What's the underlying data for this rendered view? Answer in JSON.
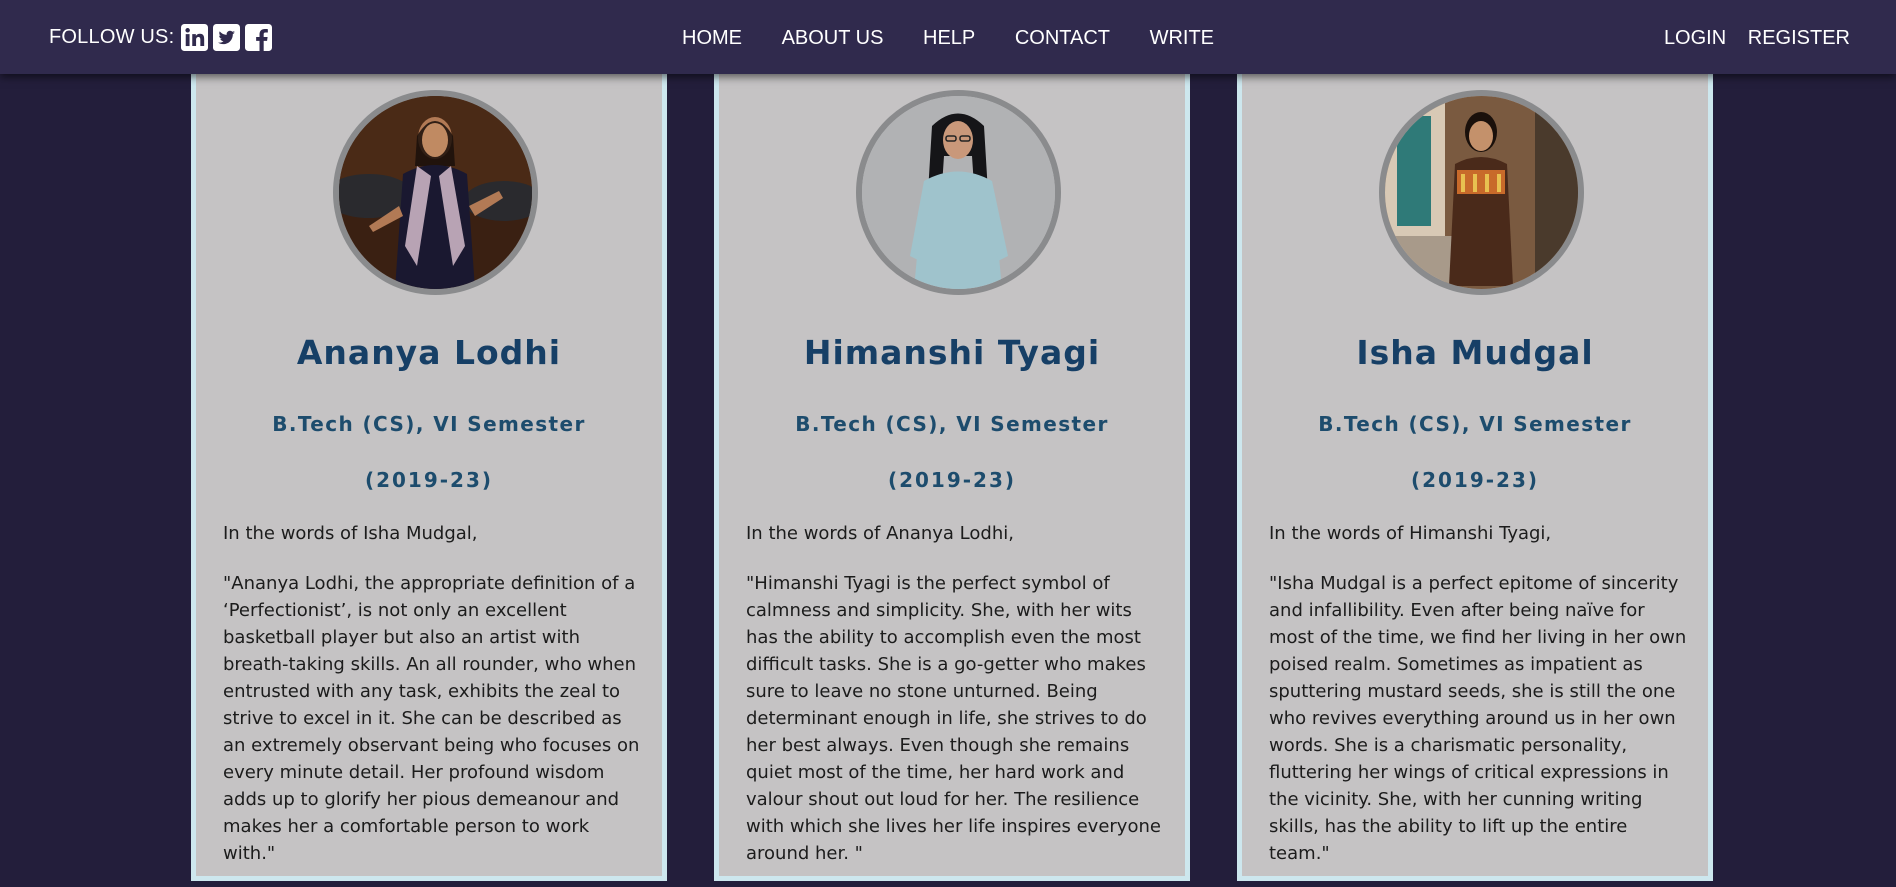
{
  "navbar": {
    "follow_label": "FOLLOW US:",
    "social_icons": [
      "linkedin-icon",
      "twitter-icon",
      "facebook-icon"
    ],
    "links": [
      "HOME",
      "ABOUT US",
      "HELP",
      "CONTACT",
      "WRITE"
    ],
    "auth": [
      "LOGIN",
      "REGISTER"
    ]
  },
  "colors": {
    "page_background": "#231e3b",
    "navbar_background": "#302a4d",
    "card_background": "#c5c3c4",
    "card_border": "#cde7ee",
    "name_color": "#163f66",
    "course_color": "#1d4c6d"
  },
  "members": [
    {
      "name": "Ananya Lodhi",
      "course": "B.Tech (CS), VI Semester",
      "years": "(2019-23)",
      "words_of": "In the words of Isha Mudgal,",
      "quote": "\"Ananya Lodhi, the appropriate definition of a ‘Perfectionist’, is not only an excellent basketball player but also an artist with breath-taking skills. An all rounder, who when entrusted with any task, exhibits the zeal to strive to excel in it. She can be described as an extremely observant being who focuses on every minute detail. Her profound wisdom adds up to glorify her pious demeanour and makes her a comfortable person to work with.\""
    },
    {
      "name": "Himanshi Tyagi",
      "course": "B.Tech (CS), VI Semester",
      "years": "(2019-23)",
      "words_of": "In the words of Ananya Lodhi,",
      "quote": "\"Himanshi Tyagi is the perfect symbol of calmness and simplicity. She, with her wits has the ability to accomplish even the most difficult tasks. She is a go-getter who makes sure to leave no stone unturned. Being determinant enough in life, she strives to do her best always. Even though she remains quiet most of the time, her hard work and valour shout out loud for her. The resilience with which she lives her life inspires everyone around her. \""
    },
    {
      "name": "Isha Mudgal",
      "course": "B.Tech (CS), VI Semester",
      "years": "(2019-23)",
      "words_of": "In the words of Himanshi Tyagi,",
      "quote": "\"Isha Mudgal is a perfect epitome of sincerity and infallibility. Even after being naïve for most of the time, we find her living in her own poised realm. Sometimes as impatient as sputtering mustard seeds, she is still the one who revives everything around us in her own words. She is a charismatic personality, fluttering her wings of critical expressions in the vicinity. She, with her cunning writing skills, has the ability to lift up the entire team.\""
    }
  ]
}
